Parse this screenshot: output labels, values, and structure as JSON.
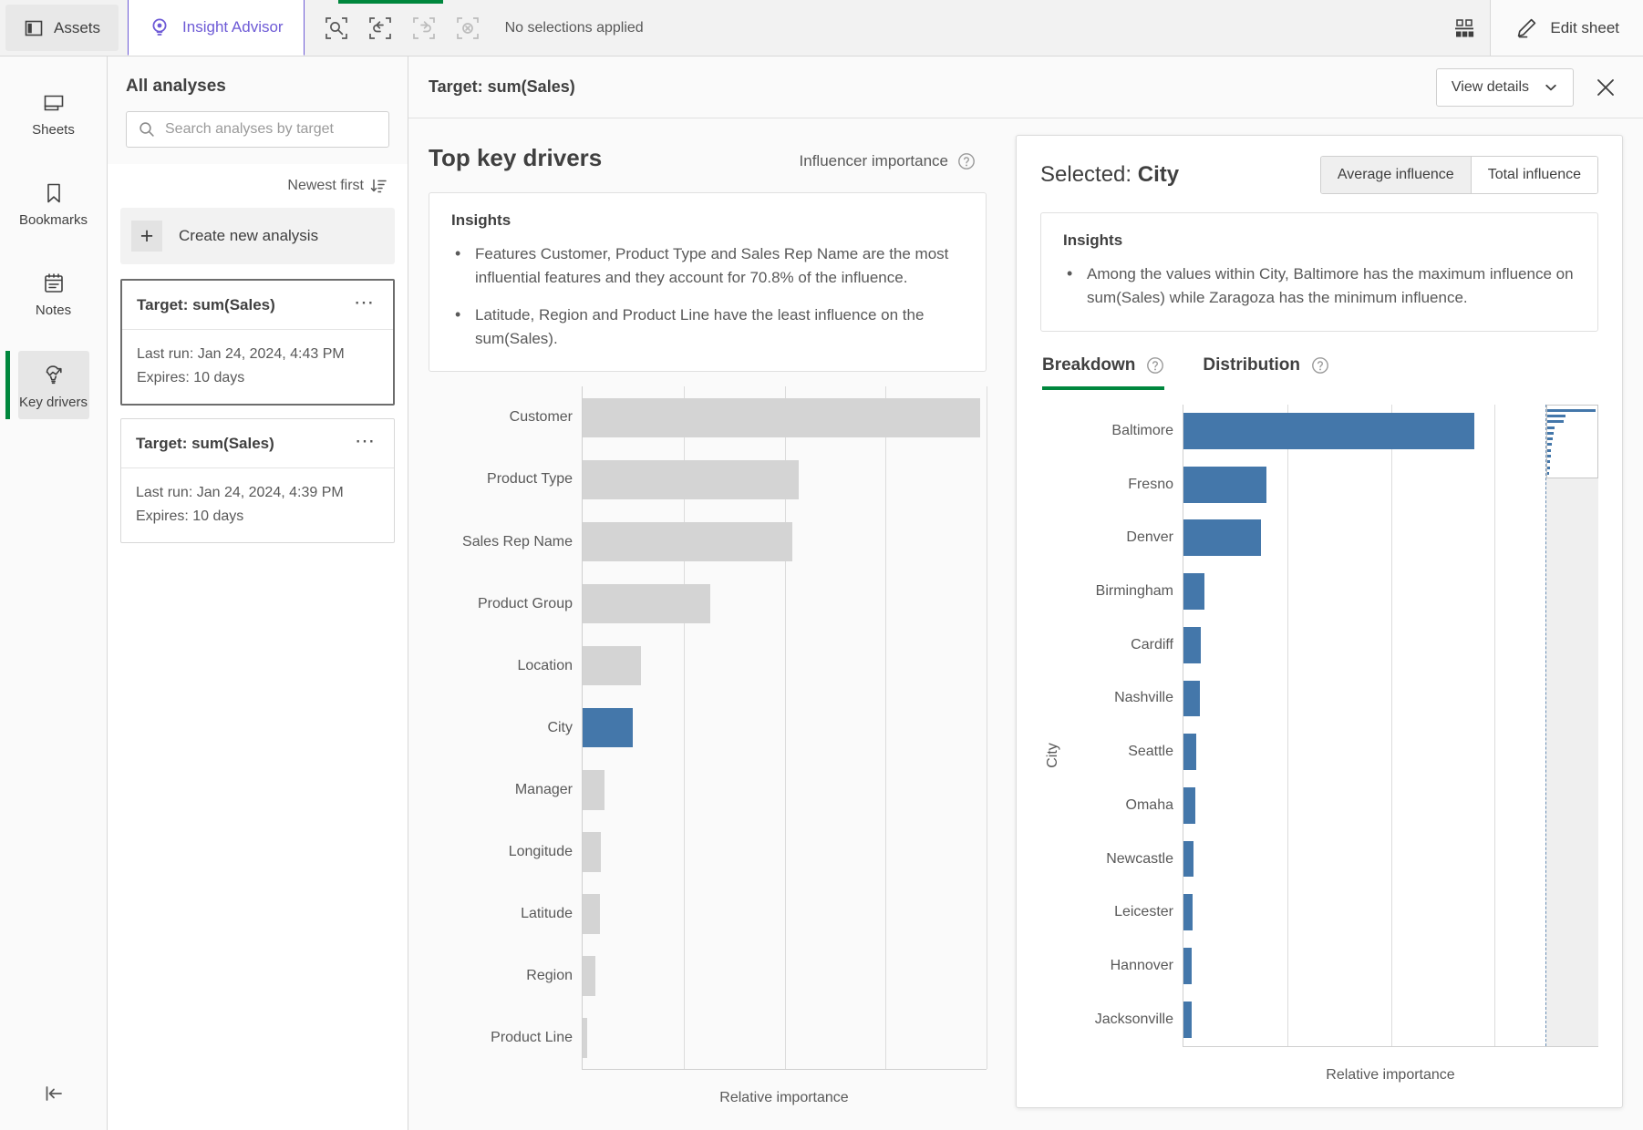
{
  "topbar": {
    "assets_label": "Assets",
    "insight_advisor_label": "Insight Advisor",
    "selection_search_icon": "selection-search-icon",
    "undo_icon": "undo-icon",
    "redo_icon": "redo-icon",
    "clear_selections_icon": "clear-selections-icon",
    "no_selections_text": "No selections applied",
    "grid_icon": "sheet-grid-icon",
    "edit_sheet_label": "Edit sheet",
    "accent_purple": "#6e5bd6",
    "accent_green": "#00873d"
  },
  "rail": {
    "items": [
      {
        "label": "Sheets",
        "icon": "sheets-icon",
        "active": false
      },
      {
        "label": "Bookmarks",
        "icon": "bookmark-icon",
        "active": false
      },
      {
        "label": "Notes",
        "icon": "notes-icon",
        "active": false
      },
      {
        "label": "Key drivers",
        "icon": "key-drivers-icon",
        "active": true
      }
    ],
    "collapse_icon": "collapse-left-icon"
  },
  "analyses": {
    "title": "All analyses",
    "search_placeholder": "Search analyses by target",
    "search_value": "",
    "search_icon": "search-icon",
    "sort_label": "Newest first",
    "sort_icon": "sort-descending-icon",
    "create_label": "Create new analysis",
    "create_icon": "plus-icon",
    "cards": [
      {
        "title": "Target: sum(Sales)",
        "last_run": "Last run: Jan 24, 2024, 4:43 PM",
        "expires": "Expires: 10 days",
        "menu_icon": "more-options-icon",
        "selected": true
      },
      {
        "title": "Target: sum(Sales)",
        "last_run": "Last run: Jan 24, 2024, 4:39 PM",
        "expires": "Expires: 10 days",
        "menu_icon": "more-options-icon",
        "selected": false
      }
    ]
  },
  "main_header": {
    "title": "Target: sum(Sales)",
    "view_details_label": "View details",
    "chevron_icon": "chevron-down-icon",
    "close_icon": "close-icon"
  },
  "left_pane": {
    "title": "Top key drivers",
    "influencer_label": "Influencer importance",
    "help_icon": "help-circle-icon",
    "insights_title": "Insights",
    "insights": [
      "Features Customer, Product Type and Sales Rep Name are the most influential features and they account for 70.8% of the influence.",
      "Latitude, Region and Product Line have the least influence on the sum(Sales)."
    ]
  },
  "right_pane": {
    "selected_prefix": "Selected: ",
    "selected_value": "City",
    "toggle": {
      "average_label": "Average influence",
      "total_label": "Total influence",
      "active": "Average influence"
    },
    "insights_title": "Insights",
    "insights": [
      "Among the values within City, Baltimore has the maximum influence on sum(Sales) while Zaragoza has the minimum influence."
    ],
    "tabs": [
      {
        "label": "Breakdown",
        "active": true,
        "help_icon": "help-circle-icon"
      },
      {
        "label": "Distribution",
        "active": false,
        "help_icon": "help-circle-icon"
      }
    ]
  },
  "chart_data": [
    {
      "id": "top-key-drivers",
      "type": "bar",
      "orientation": "horizontal",
      "title": "Top key drivers",
      "xlabel": "Relative importance",
      "ylabel": "",
      "grid": true,
      "gridline_positions_pct": [
        25,
        50,
        75,
        100
      ],
      "xlim": [
        0,
        100
      ],
      "bar_color": "#d4d4d4",
      "highlight_color": "#4477aa",
      "highlighted": "City",
      "categories": [
        "Customer",
        "Product Type",
        "Sales Rep Name",
        "Product Group",
        "Location",
        "City",
        "Manager",
        "Longitude",
        "Latitude",
        "Region",
        "Product Line"
      ],
      "values": [
        98.5,
        53.5,
        52.0,
        31.5,
        14.5,
        12.5,
        5.5,
        4.5,
        4.2,
        3.2,
        1.2
      ]
    },
    {
      "id": "city-breakdown",
      "type": "bar",
      "orientation": "horizontal",
      "title": "Breakdown",
      "xlabel": "Relative importance",
      "ylabel": "City",
      "grid": true,
      "gridline_positions_pct": [
        25,
        50,
        75
      ],
      "xlim": [
        0,
        100
      ],
      "bar_color": "#4477aa",
      "categories": [
        "Baltimore",
        "Fresno",
        "Denver",
        "Birmingham",
        "Cardiff",
        "Nashville",
        "Seattle",
        "Omaha",
        "Newcastle",
        "Leicester",
        "Hannover",
        "Jacksonville"
      ],
      "values": [
        75.5,
        21.5,
        20.0,
        5.5,
        4.5,
        4.2,
        3.2,
        3.0,
        2.6,
        2.4,
        2.2,
        2.1
      ],
      "overview_bars_pct": [
        97,
        36,
        33,
        14,
        12,
        10,
        9,
        8,
        7,
        6,
        5,
        4
      ],
      "overview_axis_label": "Relative importance"
    }
  ]
}
